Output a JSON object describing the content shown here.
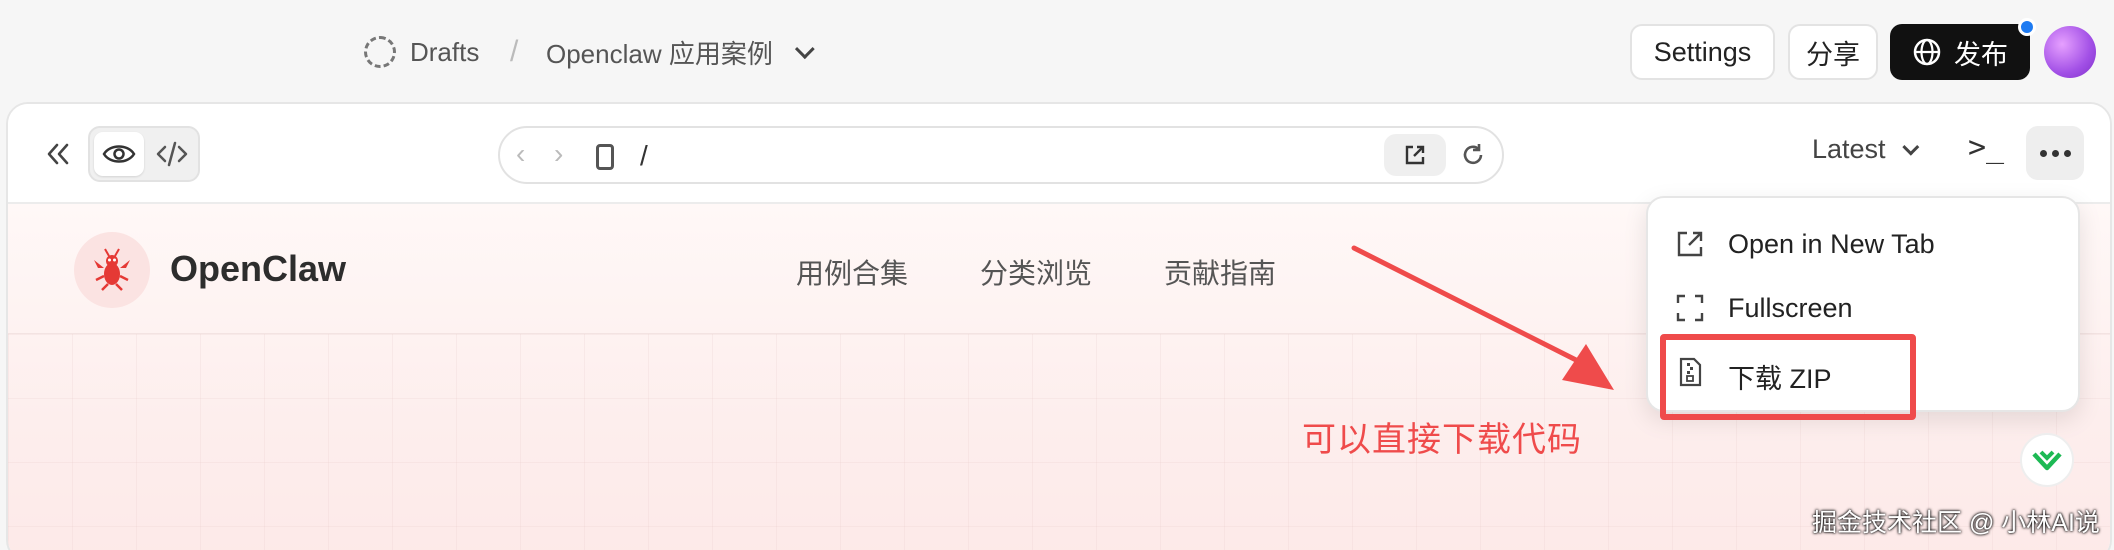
{
  "header": {
    "breadcrumb": {
      "drafts": "Drafts",
      "separator": "/",
      "project": "Openclaw 应用案例"
    },
    "buttons": {
      "settings": "Settings",
      "share": "分享",
      "publish": "发布"
    }
  },
  "toolbar": {
    "url_path": "/",
    "version": "Latest",
    "terminal": ">_"
  },
  "site": {
    "brand": "OpenClaw",
    "nav": [
      "用例合集",
      "分类浏览",
      "贡献指南"
    ]
  },
  "menu": {
    "items": [
      {
        "label": "Open in New Tab",
        "icon": "external-link-icon"
      },
      {
        "label": "Fullscreen",
        "icon": "fullscreen-icon"
      },
      {
        "label": "下载 ZIP",
        "icon": "zip-file-icon"
      }
    ]
  },
  "annotation": {
    "text": "可以直接下载代码",
    "color": "#ef4b4b"
  },
  "watermark": "掘金技术社区 @ 小林AI说",
  "colors": {
    "publish_bg": "#111111",
    "notify_dot": "#1e7bf2",
    "brand_red": "#e53935"
  }
}
